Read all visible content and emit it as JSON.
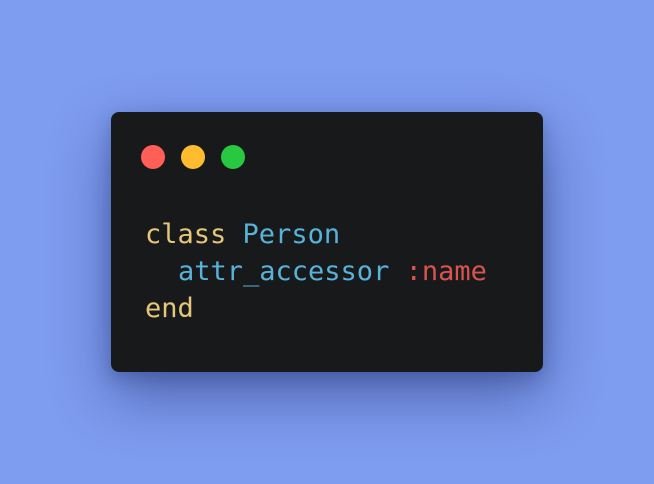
{
  "colors": {
    "background": "#7e9cf0",
    "window": "#18191b",
    "close": "#ff5f57",
    "minimize": "#febc2e",
    "zoom": "#28c840",
    "keyword": "#e6c77a",
    "constant": "#57b3d9",
    "method": "#57b3d9",
    "symbol": "#d9534f"
  },
  "window_controls": {
    "close_icon": "close-dot",
    "minimize_icon": "minimize-dot",
    "zoom_icon": "zoom-dot"
  },
  "code": {
    "line1": {
      "keyword": "class",
      "space": " ",
      "constant": "Person"
    },
    "line2": {
      "method": "attr_accessor",
      "space": " ",
      "symbol": ":name"
    },
    "line3": {
      "keyword": "end"
    }
  }
}
